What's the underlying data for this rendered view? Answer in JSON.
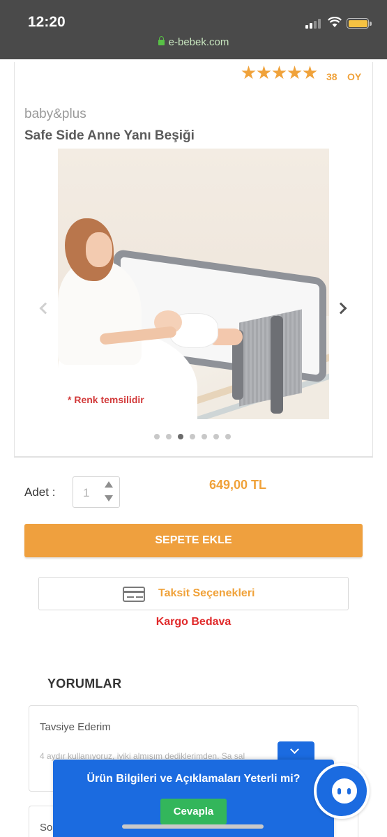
{
  "status_bar": {
    "time": "12:20",
    "url": "e-bebek.com"
  },
  "product": {
    "rating_stars": 5,
    "review_count": "38",
    "review_unit": "OY",
    "brand": "baby&plus",
    "title": "Safe Side Anne Yanı Beşiği",
    "image_caption": "* Renk temsilidir",
    "carousel_total": 7,
    "carousel_active_index": 2
  },
  "purchase": {
    "quantity_label": "Adet :",
    "quantity_value": "1",
    "price": "649,00 TL",
    "add_to_cart_label": "SEPETE EKLE",
    "installment_label": "Taksit Seçenekleri",
    "shipping_label": "Kargo Bedava"
  },
  "reviews": {
    "heading": "YORUMLAR",
    "items": [
      {
        "title": "Tavsiye Ederim",
        "text": "4 aydır kullanıyoruz, iyiki almışım dediklerimden. Sa sal"
      },
      {
        "title": "So"
      }
    ]
  },
  "survey": {
    "question": "Ürün Bilgileri ve Açıklamaları Yeterli mi?",
    "button_label": "Cevapla"
  },
  "colors": {
    "accent_orange": "#efa03e",
    "shipping_red": "#e0292a",
    "survey_blue": "#1b6be0",
    "survey_green": "#33b65b"
  },
  "icons": [
    "lock-icon",
    "signal-icon",
    "wifi-icon",
    "battery-icon",
    "star-icon",
    "chevron-left-icon",
    "chevron-right-icon",
    "credit-card-icon",
    "chevron-down-icon",
    "chat-bot-icon"
  ]
}
